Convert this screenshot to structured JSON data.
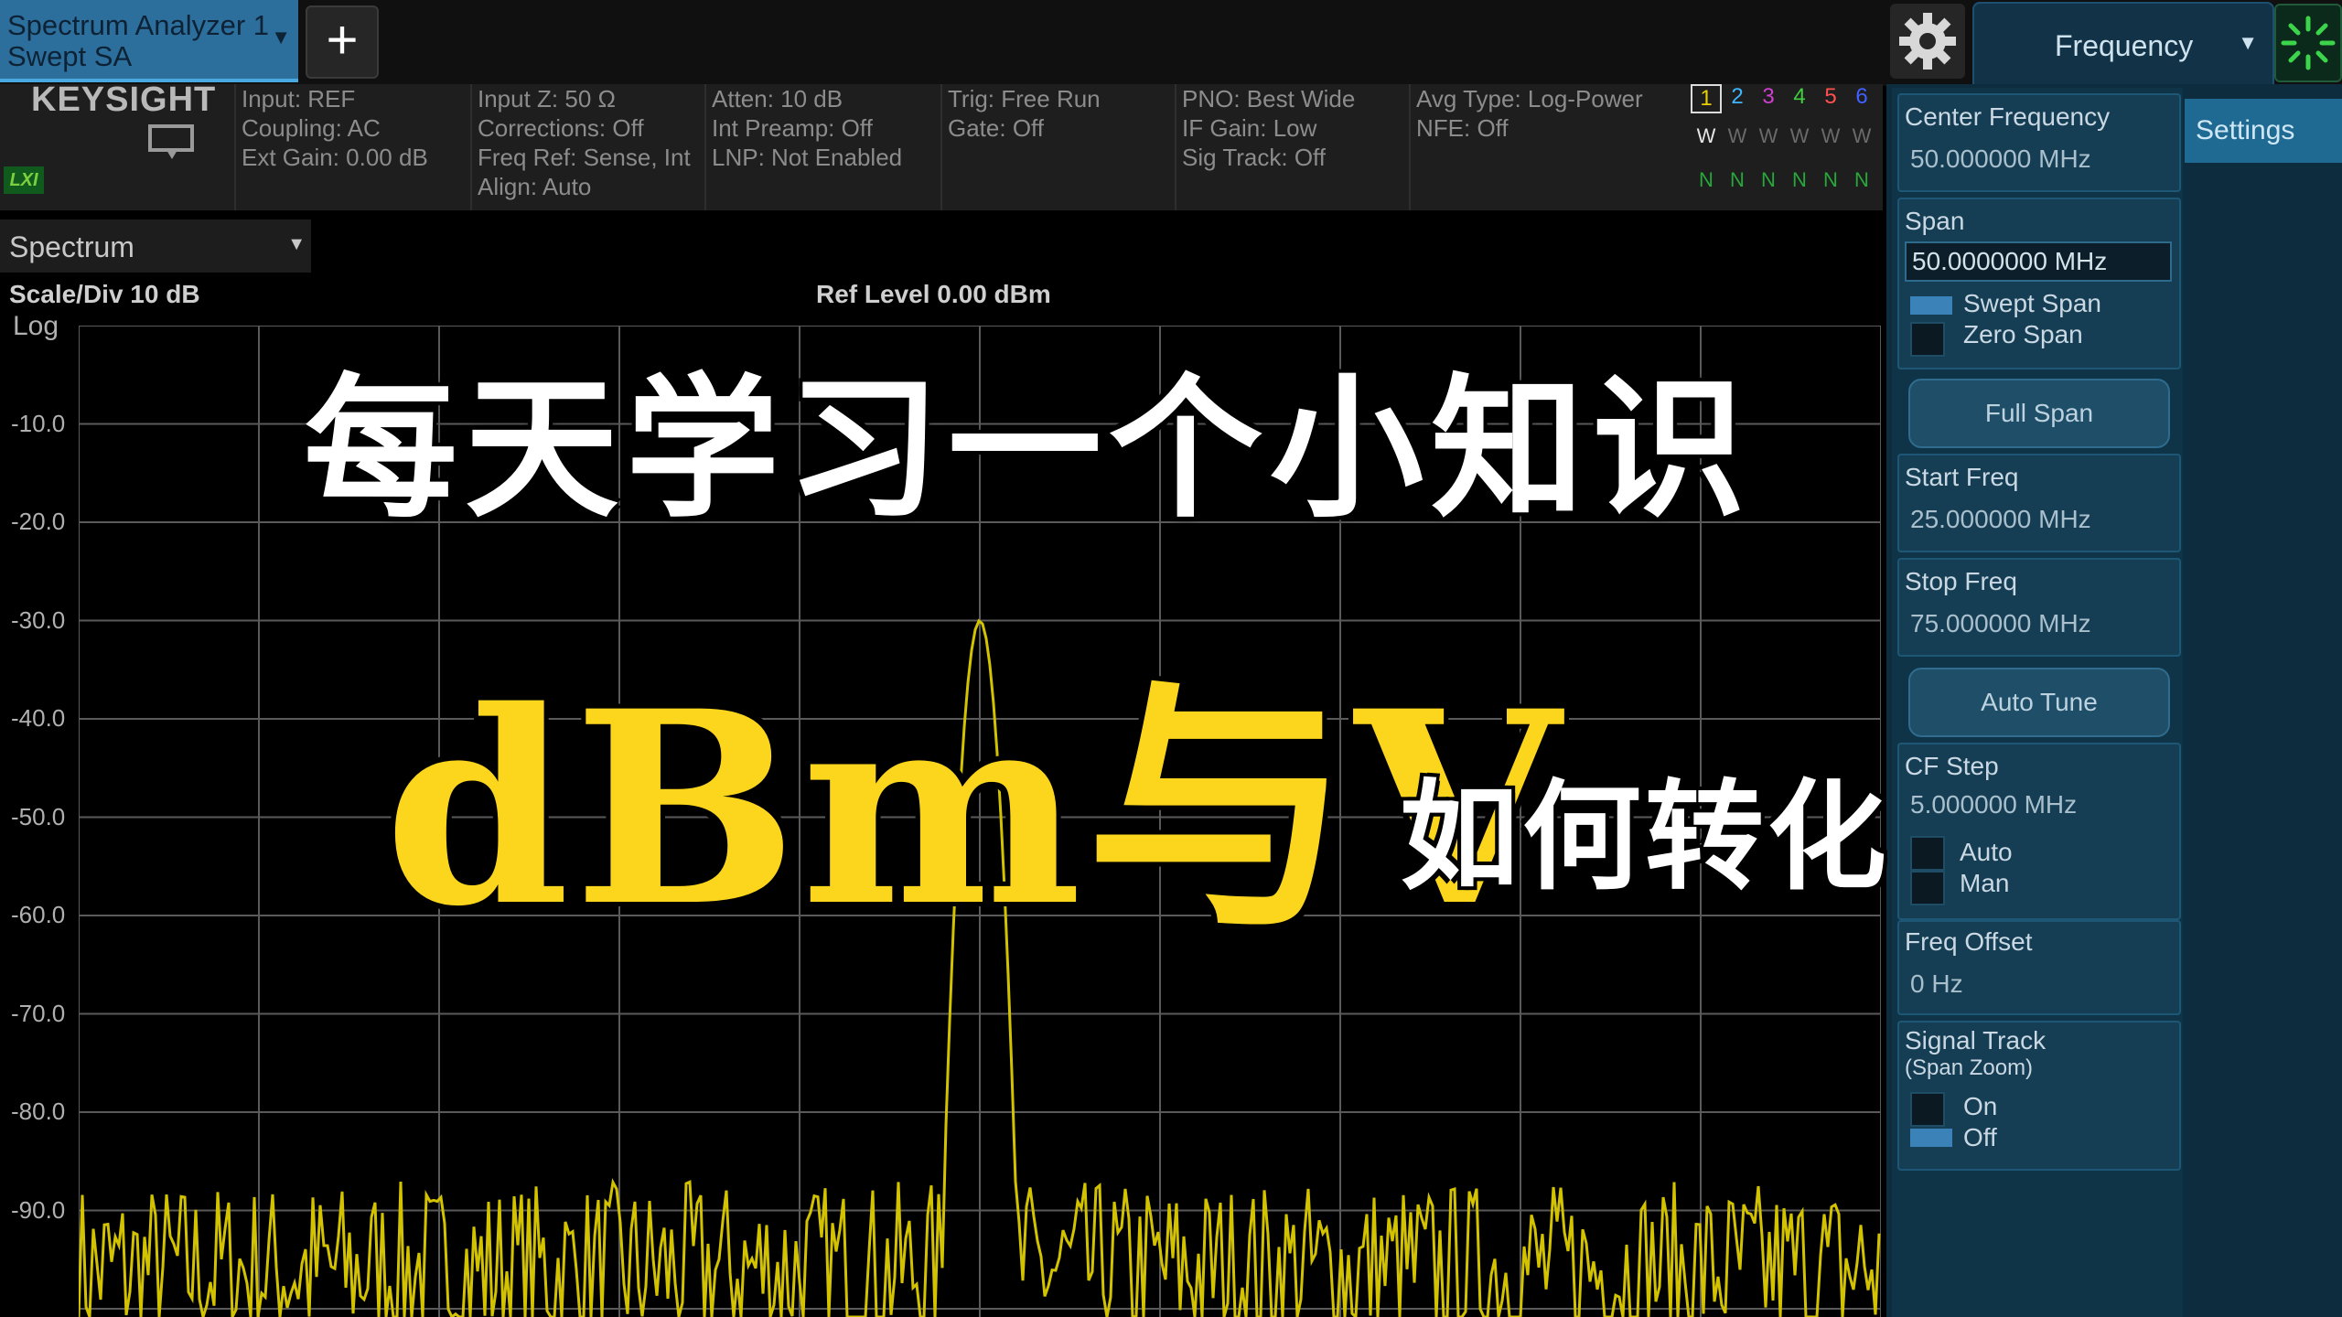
{
  "app": {
    "tab_title": "Spectrum Analyzer 1",
    "tab_subtitle": "Swept SA",
    "add_tab": "+",
    "menu": "Frequency",
    "brand": "KEYSIGHT",
    "lxi": "LXI"
  },
  "meas_bar": {
    "col1": [
      "Input: REF",
      "Coupling: AC",
      "Ext Gain: 0.00 dB"
    ],
    "col2": [
      "Input Z: 50 Ω",
      "Corrections: Off",
      "Freq Ref: Sense, Int",
      "Align: Auto"
    ],
    "col3": [
      "Atten: 10 dB",
      "Int Preamp: Off",
      "LNP: Not Enabled"
    ],
    "col4": [
      "Trig: Free Run",
      "Gate: Off"
    ],
    "col5": [
      "PNO: Best Wide",
      "IF Gain: Low",
      "Sig Track: Off"
    ],
    "col6": [
      "Avg Type: Log-Power",
      "NFE: Off"
    ],
    "traces": {
      "numbers": [
        "1",
        "2",
        "3",
        "4",
        "5",
        "6"
      ],
      "colors": [
        "#e8d000",
        "#3fb6ff",
        "#d040d0",
        "#3fd040",
        "#ff5050",
        "#4060ff"
      ],
      "types": [
        "W",
        "W",
        "W",
        "W",
        "W",
        "W"
      ],
      "dets": [
        "N",
        "N",
        "N",
        "N",
        "N",
        "N"
      ]
    }
  },
  "spectrum": {
    "view": "Spectrum",
    "scale": "Scale/Div 10 dB",
    "scale_type": "Log",
    "ref_level": "Ref Level 0.00 dBm",
    "y_ticks": [
      "-10.0",
      "-20.0",
      "-30.0",
      "-40.0",
      "-50.0",
      "-60.0",
      "-70.0",
      "-80.0",
      "-90.0"
    ],
    "trace_color": "#d2c200"
  },
  "panel": {
    "settings_tab": "Settings",
    "center_freq_label": "Center Frequency",
    "center_freq_value": "50.000000 MHz",
    "span_label": "Span",
    "span_value": "50.0000000 MHz",
    "swept_span": "Swept Span",
    "zero_span": "Zero Span",
    "full_span": "Full Span",
    "start_freq_label": "Start Freq",
    "start_freq_value": "25.000000 MHz",
    "stop_freq_label": "Stop Freq",
    "stop_freq_value": "75.000000 MHz",
    "auto_tune": "Auto Tune",
    "cf_step_label": "CF Step",
    "cf_step_value": "5.000000 MHz",
    "auto": "Auto",
    "man": "Man",
    "freq_offset_label": "Freq Offset",
    "freq_offset_value": "0 Hz",
    "signal_track_label": "Signal Track",
    "signal_track_sub": "(Span Zoom)",
    "on": "On",
    "off": "Off"
  },
  "overlay": {
    "headline": "每天学习一个小知识",
    "title": "dBm与V",
    "subtitle": "如何转化"
  }
}
